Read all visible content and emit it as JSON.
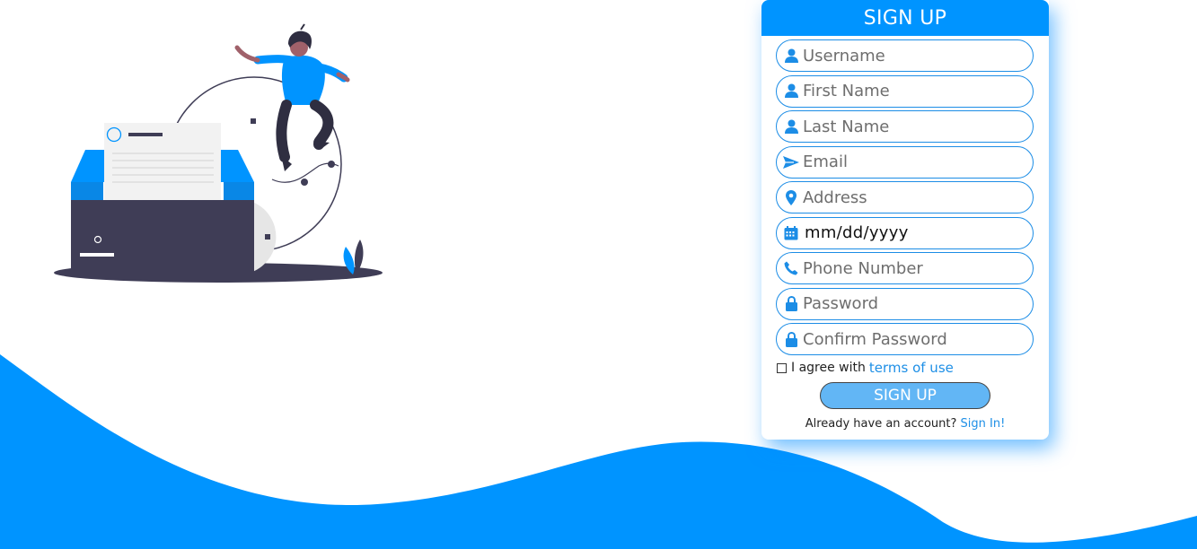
{
  "colors": {
    "accent": "#0094ff",
    "button": "#62b6f5",
    "link": "#1e8fe6",
    "dark": "#3f3d56"
  },
  "form": {
    "title": "SIGN UP",
    "fields": [
      {
        "name": "username",
        "icon": "user-icon",
        "placeholder": "Username"
      },
      {
        "name": "first_name",
        "icon": "user-icon",
        "placeholder": "First Name"
      },
      {
        "name": "last_name",
        "icon": "user-icon",
        "placeholder": "Last Name"
      },
      {
        "name": "email",
        "icon": "paper-plane-icon",
        "placeholder": "Email"
      },
      {
        "name": "address",
        "icon": "map-pin-icon",
        "placeholder": "Address"
      },
      {
        "name": "dob",
        "icon": "calendar-icon",
        "placeholder": "mm/dd/yyyy"
      },
      {
        "name": "phone",
        "icon": "phone-icon",
        "placeholder": "Phone Number"
      },
      {
        "name": "password",
        "icon": "lock-icon",
        "placeholder": "Password"
      },
      {
        "name": "confirm_password",
        "icon": "lock-icon",
        "placeholder": "Confirm Password"
      }
    ],
    "agree_text": "I agree with",
    "terms_link": "terms of use",
    "submit_label": "SIGN UP",
    "account_text": "Already have an account?",
    "signin_link": "Sign In!"
  }
}
